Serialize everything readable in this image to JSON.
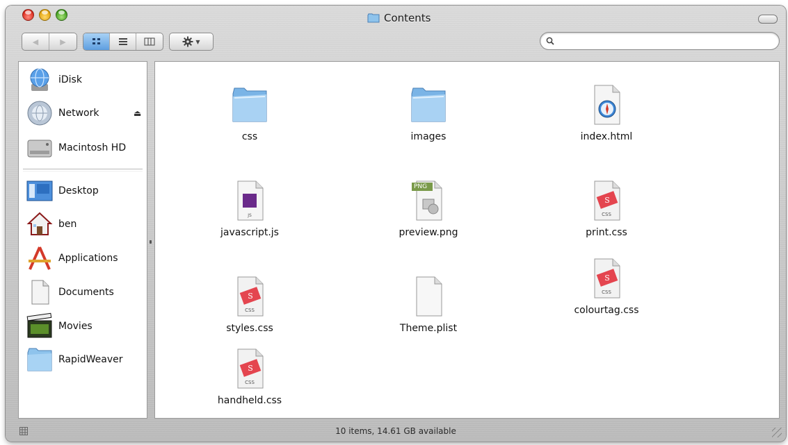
{
  "window": {
    "title": "Contents",
    "title_icon": "folder-icon"
  },
  "toolbar": {
    "back_icon": "back-arrow-icon",
    "forward_icon": "forward-arrow-icon",
    "view_icons": [
      "icon-view-icon",
      "list-view-icon",
      "column-view-icon"
    ],
    "active_view": "icon-view",
    "action_icon": "gear-icon",
    "search": {
      "value": "",
      "icon": "magnifier-icon"
    }
  },
  "sidebar": {
    "devices": [
      {
        "label": "iDisk",
        "icon": "idisk-globe-icon"
      },
      {
        "label": "Network",
        "icon": "network-globe-icon",
        "eject": "⏏"
      },
      {
        "label": "Macintosh HD",
        "icon": "hard-drive-icon"
      }
    ],
    "places": [
      {
        "label": "Desktop",
        "icon": "desktop-icon"
      },
      {
        "label": "ben",
        "icon": "home-icon"
      },
      {
        "label": "Applications",
        "icon": "applications-icon"
      },
      {
        "label": "Documents",
        "icon": "documents-icon"
      },
      {
        "label": "Movies",
        "icon": "movies-icon"
      },
      {
        "label": "RapidWeaver",
        "icon": "folder-icon"
      }
    ]
  },
  "files": [
    {
      "name": "css",
      "kind": "folder"
    },
    {
      "name": "images",
      "kind": "folder"
    },
    {
      "name": "index.html",
      "kind": "html"
    },
    {
      "name": "javascript.js",
      "kind": "js"
    },
    {
      "name": "preview.png",
      "kind": "png",
      "badge": "PNG"
    },
    {
      "name": "print.css",
      "kind": "css",
      "badge": "CSS"
    },
    {
      "name": "styles.css",
      "kind": "css",
      "badge": "CSS"
    },
    {
      "name": "Theme.plist",
      "kind": "plist"
    },
    {
      "name": "colourtag.css",
      "kind": "css",
      "badge": "CSS"
    },
    {
      "name": "handheld.css",
      "kind": "css",
      "badge": "CSS"
    }
  ],
  "status": {
    "text": "10 items, 14.61 GB available"
  },
  "colors": {
    "selected_view": "#5e9fe0",
    "css_badge": "#e4454f",
    "folder_blue": "#8ec3ec"
  }
}
